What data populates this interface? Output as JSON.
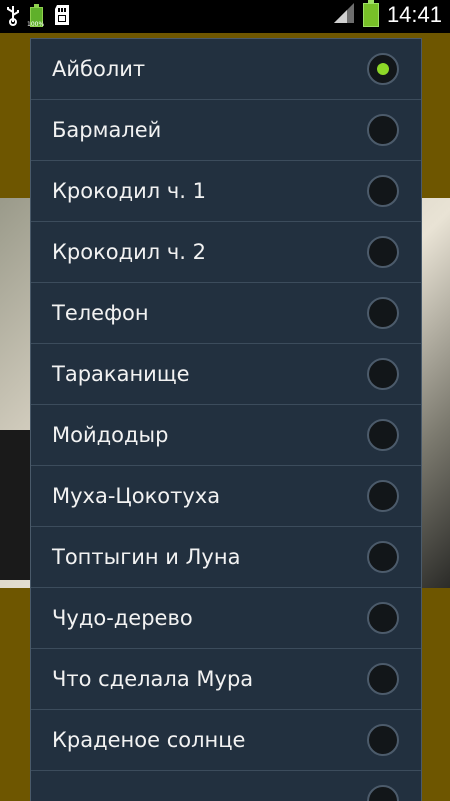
{
  "status_bar": {
    "time": "14:41",
    "battery_small_label": "100%",
    "icons": [
      "usb-icon",
      "battery-full-icon",
      "sd-card-icon",
      "signal-icon",
      "battery-icon"
    ]
  },
  "dialog": {
    "items": [
      {
        "label": "Айболит",
        "selected": true
      },
      {
        "label": "Бармалей",
        "selected": false
      },
      {
        "label": "Крокодил ч. 1",
        "selected": false
      },
      {
        "label": "Крокодил ч. 2",
        "selected": false
      },
      {
        "label": "Телефон",
        "selected": false
      },
      {
        "label": "Тараканище",
        "selected": false
      },
      {
        "label": "Мойдодыр",
        "selected": false
      },
      {
        "label": "Муха-Цокотуха",
        "selected": false
      },
      {
        "label": "Топтыгин и Луна",
        "selected": false
      },
      {
        "label": "Чудо-дерево",
        "selected": false
      },
      {
        "label": "Что сделала Мура",
        "selected": false
      },
      {
        "label": "Краденое солнце",
        "selected": false
      },
      {
        "label": "",
        "selected": false
      }
    ]
  },
  "colors": {
    "accent": "#8ed828",
    "dialog_bg": "#22303f",
    "app_bg": "#6e5600"
  }
}
